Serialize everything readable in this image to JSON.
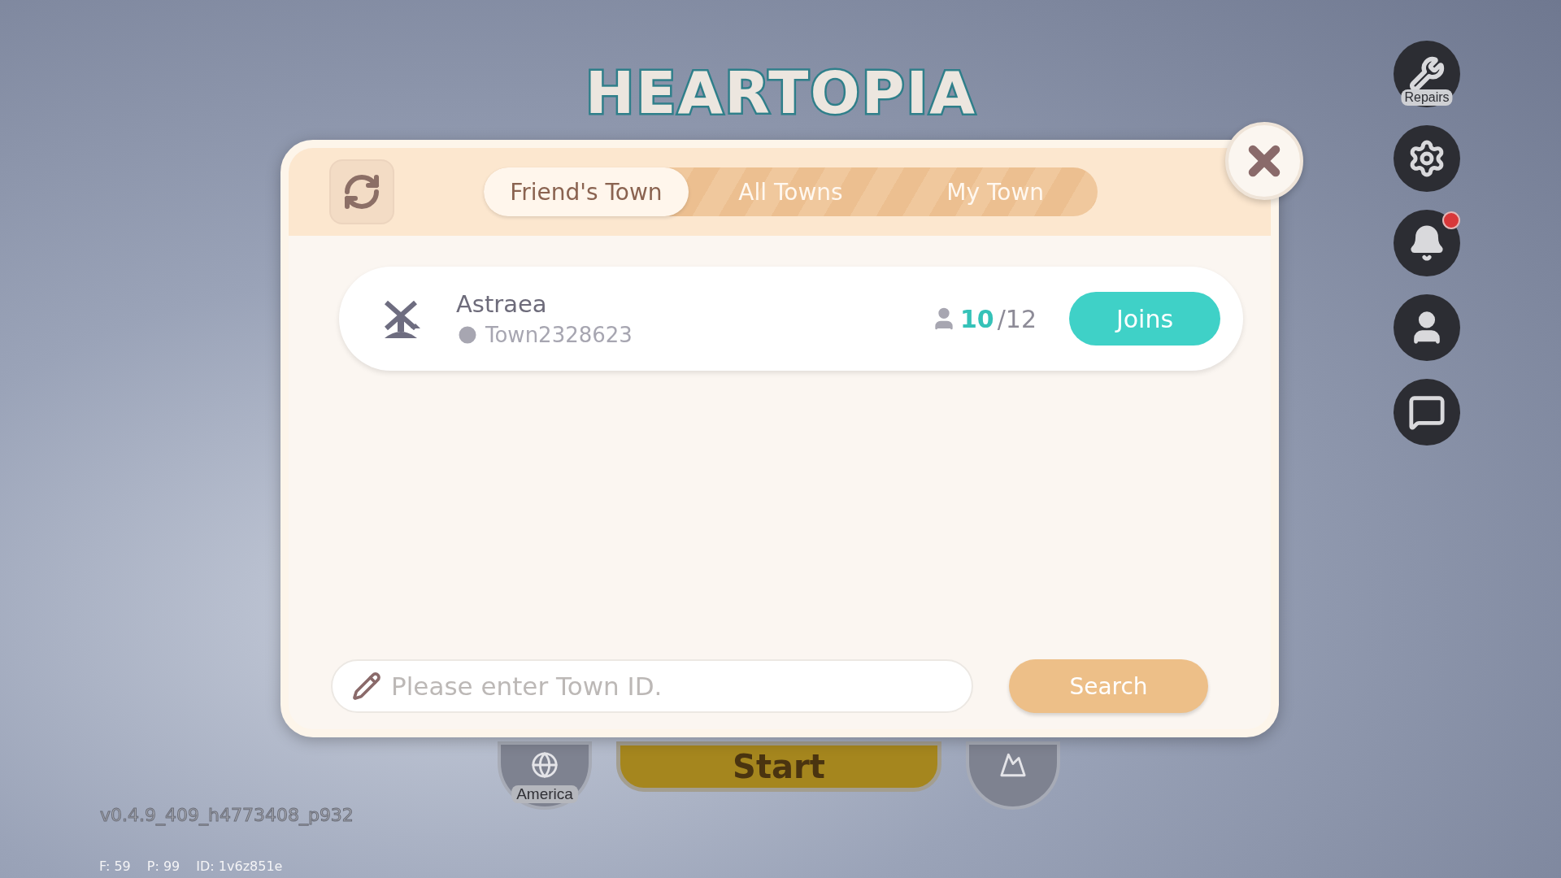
{
  "logo": "HEARTOPIA",
  "side_buttons": [
    {
      "kind": "repairs",
      "label": "Repairs",
      "unread": false
    },
    {
      "kind": "settings",
      "unread": false
    },
    {
      "kind": "notifications",
      "unread": true
    },
    {
      "kind": "profile",
      "unread": false
    },
    {
      "kind": "language",
      "unread": false
    }
  ],
  "dialog": {
    "tabs": [
      {
        "label": "Friend's Town",
        "selected": true
      },
      {
        "label": "All Towns",
        "selected": false
      },
      {
        "label": "My Town",
        "selected": false
      }
    ],
    "towns": [
      {
        "name": "Astraea",
        "town_id": "Town2328623",
        "players": "10",
        "capacity": "/12",
        "action": "Joins"
      }
    ],
    "search": {
      "placeholder": "Please enter Town ID.",
      "button": "Search"
    }
  },
  "bottom_bar": {
    "region": "America",
    "start": "Start"
  },
  "version": "v0.4.9_409_h4773408_p932",
  "stats": [
    "F: 59",
    "P: 99",
    "ID: 1v6z851e"
  ]
}
